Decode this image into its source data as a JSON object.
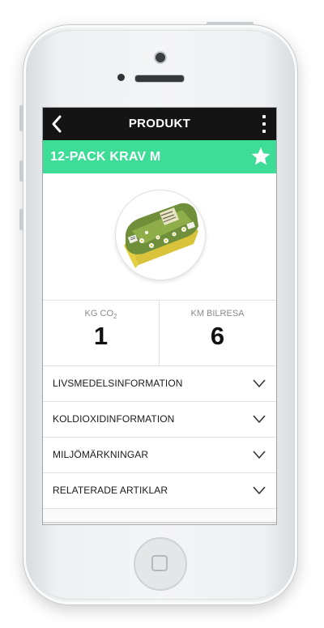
{
  "header": {
    "title": "PRODUKT",
    "back_icon": "chevron-left-icon",
    "menu_icon": "more-vertical-icon"
  },
  "product": {
    "name": "12-PACK KRAV M",
    "favorite_icon": "star-icon"
  },
  "stats": {
    "co2_label_main": "KG CO",
    "co2_label_sub": "2",
    "co2_value": "1",
    "car_label": "KM BILRESA",
    "car_value": "6"
  },
  "sections": [
    {
      "label": "LIVSMEDELSINFORMATION"
    },
    {
      "label": "KOLDIOXIDINFORMATION"
    },
    {
      "label": "MILJÖMÄRKNINGAR"
    },
    {
      "label": "RELATERADE ARTIKLAR"
    }
  ],
  "colors": {
    "navbar": "#141414",
    "accent_green": "#3ddc97"
  }
}
